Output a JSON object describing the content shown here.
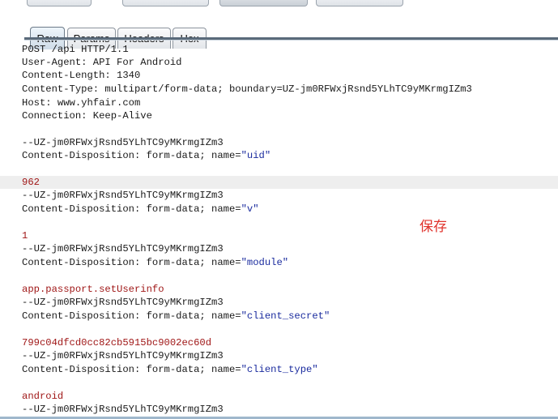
{
  "tabs": [
    {
      "label": "Raw",
      "active": true
    },
    {
      "label": "Params",
      "active": false
    },
    {
      "label": "Headers",
      "active": false
    },
    {
      "label": "Hex",
      "active": false
    }
  ],
  "request": {
    "l1": "POST /api HTTP/1.1",
    "l2": "User-Agent: API For Android",
    "l3": "Content-Length: 1340",
    "l4": "Content-Type: multipart/form-data; boundary=UZ-jm0RFWxjRsnd5YLhTC9yMKrmgIZm3",
    "l5": "Host: www.yhfair.com",
    "l6": "Connection: Keep-Alive",
    "b1": "--UZ-jm0RFWxjRsnd5YLhTC9yMKrmgIZm3",
    "d1_prefix": "Content-Disposition: form-data; name=",
    "d1_name": "\"uid\"",
    "v1": "962",
    "b2": "--UZ-jm0RFWxjRsnd5YLhTC9yMKrmgIZm3",
    "d2_prefix": "Content-Disposition: form-data; name=",
    "d2_name": "\"v\"",
    "v2": "1",
    "b3": "--UZ-jm0RFWxjRsnd5YLhTC9yMKrmgIZm3",
    "d3_prefix": "Content-Disposition: form-data; name=",
    "d3_name": "\"module\"",
    "v3": "app.passport.setUserinfo",
    "b4": "--UZ-jm0RFWxjRsnd5YLhTC9yMKrmgIZm3",
    "d4_prefix": "Content-Disposition: form-data; name=",
    "d4_name": "\"client_secret\"",
    "v4": "799c04dfcd0cc82cb5915bc9002ec60d",
    "b5": "--UZ-jm0RFWxjRsnd5YLhTC9yMKrmgIZm3",
    "d5_prefix": "Content-Disposition: form-data; name=",
    "d5_name": "\"client_type\"",
    "v5": "android",
    "b6": "--UZ-jm0RFWxjRsnd5YLhTC9yMKrmgIZm3"
  },
  "annotation": "保存"
}
